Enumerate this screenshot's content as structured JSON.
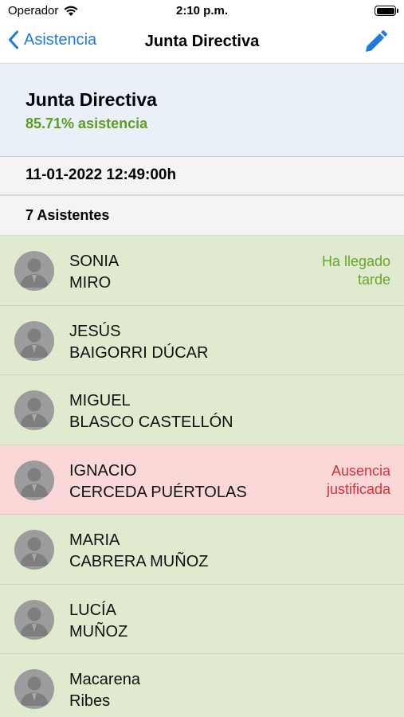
{
  "status_bar": {
    "carrier": "Operador",
    "time": "2:10 p.m."
  },
  "nav": {
    "back_label": "Asistencia",
    "title": "Junta Directiva",
    "edit_icon": "pencil-icon",
    "accent_color": "#1f7ae0"
  },
  "summary": {
    "title": "Junta Directiva",
    "attendance": "85.71% asistencia"
  },
  "meeting": {
    "datetime": "11-01-2022 12:49:00h",
    "attendees_label": "7 Asistentes"
  },
  "colors": {
    "present_bg": "#dfeacf",
    "absent_bg": "#fbd8d8",
    "late_text": "#6aa52a",
    "justified_text": "#d9303c"
  },
  "attendees": [
    {
      "first": "SONIA",
      "last": "MIRO",
      "note_line1": "Ha llegado",
      "note_line2": "tarde",
      "status": "late"
    },
    {
      "first": "JESÚS",
      "last": "BAIGORRI DÚCAR",
      "note_line1": "",
      "note_line2": "",
      "status": "present"
    },
    {
      "first": "MIGUEL",
      "last": "BLASCO CASTELLÓN",
      "note_line1": "",
      "note_line2": "",
      "status": "present"
    },
    {
      "first": "IGNACIO",
      "last": "CERCEDA PUÉRTOLAS",
      "note_line1": "Ausencia",
      "note_line2": "justificada",
      "status": "justified"
    },
    {
      "first": "MARIA",
      "last": "CABRERA MUÑOZ",
      "note_line1": "",
      "note_line2": "",
      "status": "present"
    },
    {
      "first": "LUCÍA",
      "last": "MUÑOZ",
      "note_line1": "",
      "note_line2": "",
      "status": "present"
    },
    {
      "first": "Macarena",
      "last": "Ribes",
      "note_line1": "",
      "note_line2": "",
      "status": "present"
    }
  ]
}
